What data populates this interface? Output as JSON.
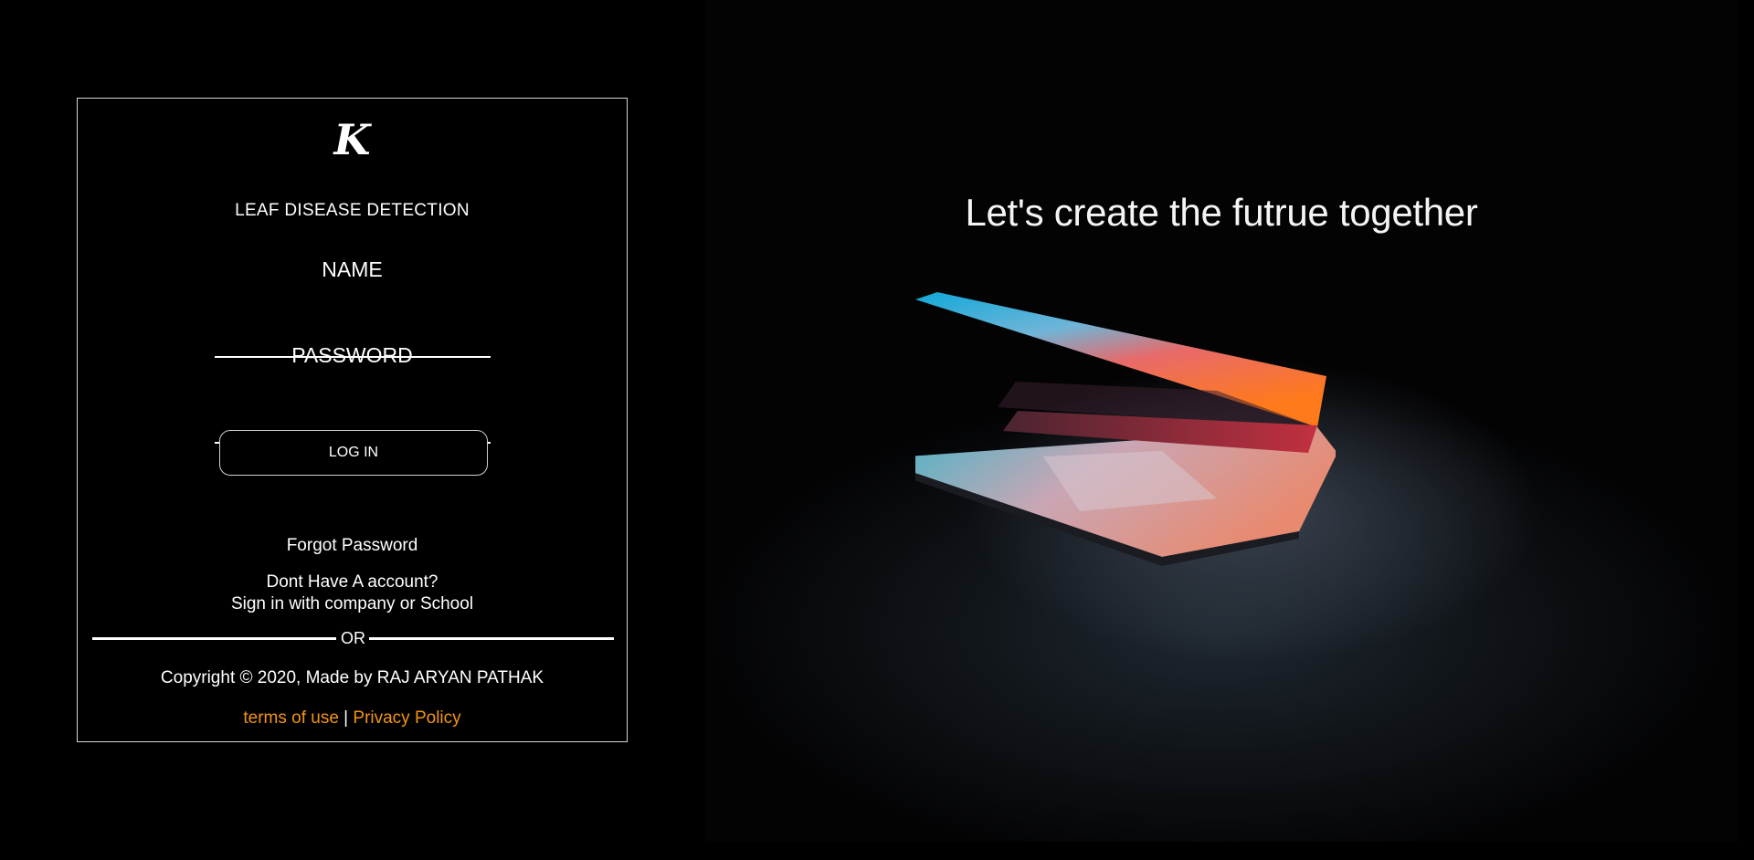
{
  "login": {
    "logo": "K",
    "app_title": "LEAF DISEASE DETECTION",
    "name_label": "NAME",
    "name_value": "",
    "password_label": "PASSWORD",
    "password_value": "",
    "login_button": "LOG IN",
    "forgot_password": "Forgot Password",
    "no_account": "Dont Have A account?",
    "sign_in_alt": "Sign in with company or School",
    "or_text": "OR",
    "copyright": "Copyright © 2020, Made by RAJ ARYAN PATHAK",
    "terms_link": "terms of use",
    "separator": "|",
    "privacy_link": "Privacy Policy"
  },
  "hero": {
    "title": "Let's create the futrue together"
  },
  "colors": {
    "background": "#000000",
    "link": "#f39414",
    "text": "#ffffff"
  }
}
